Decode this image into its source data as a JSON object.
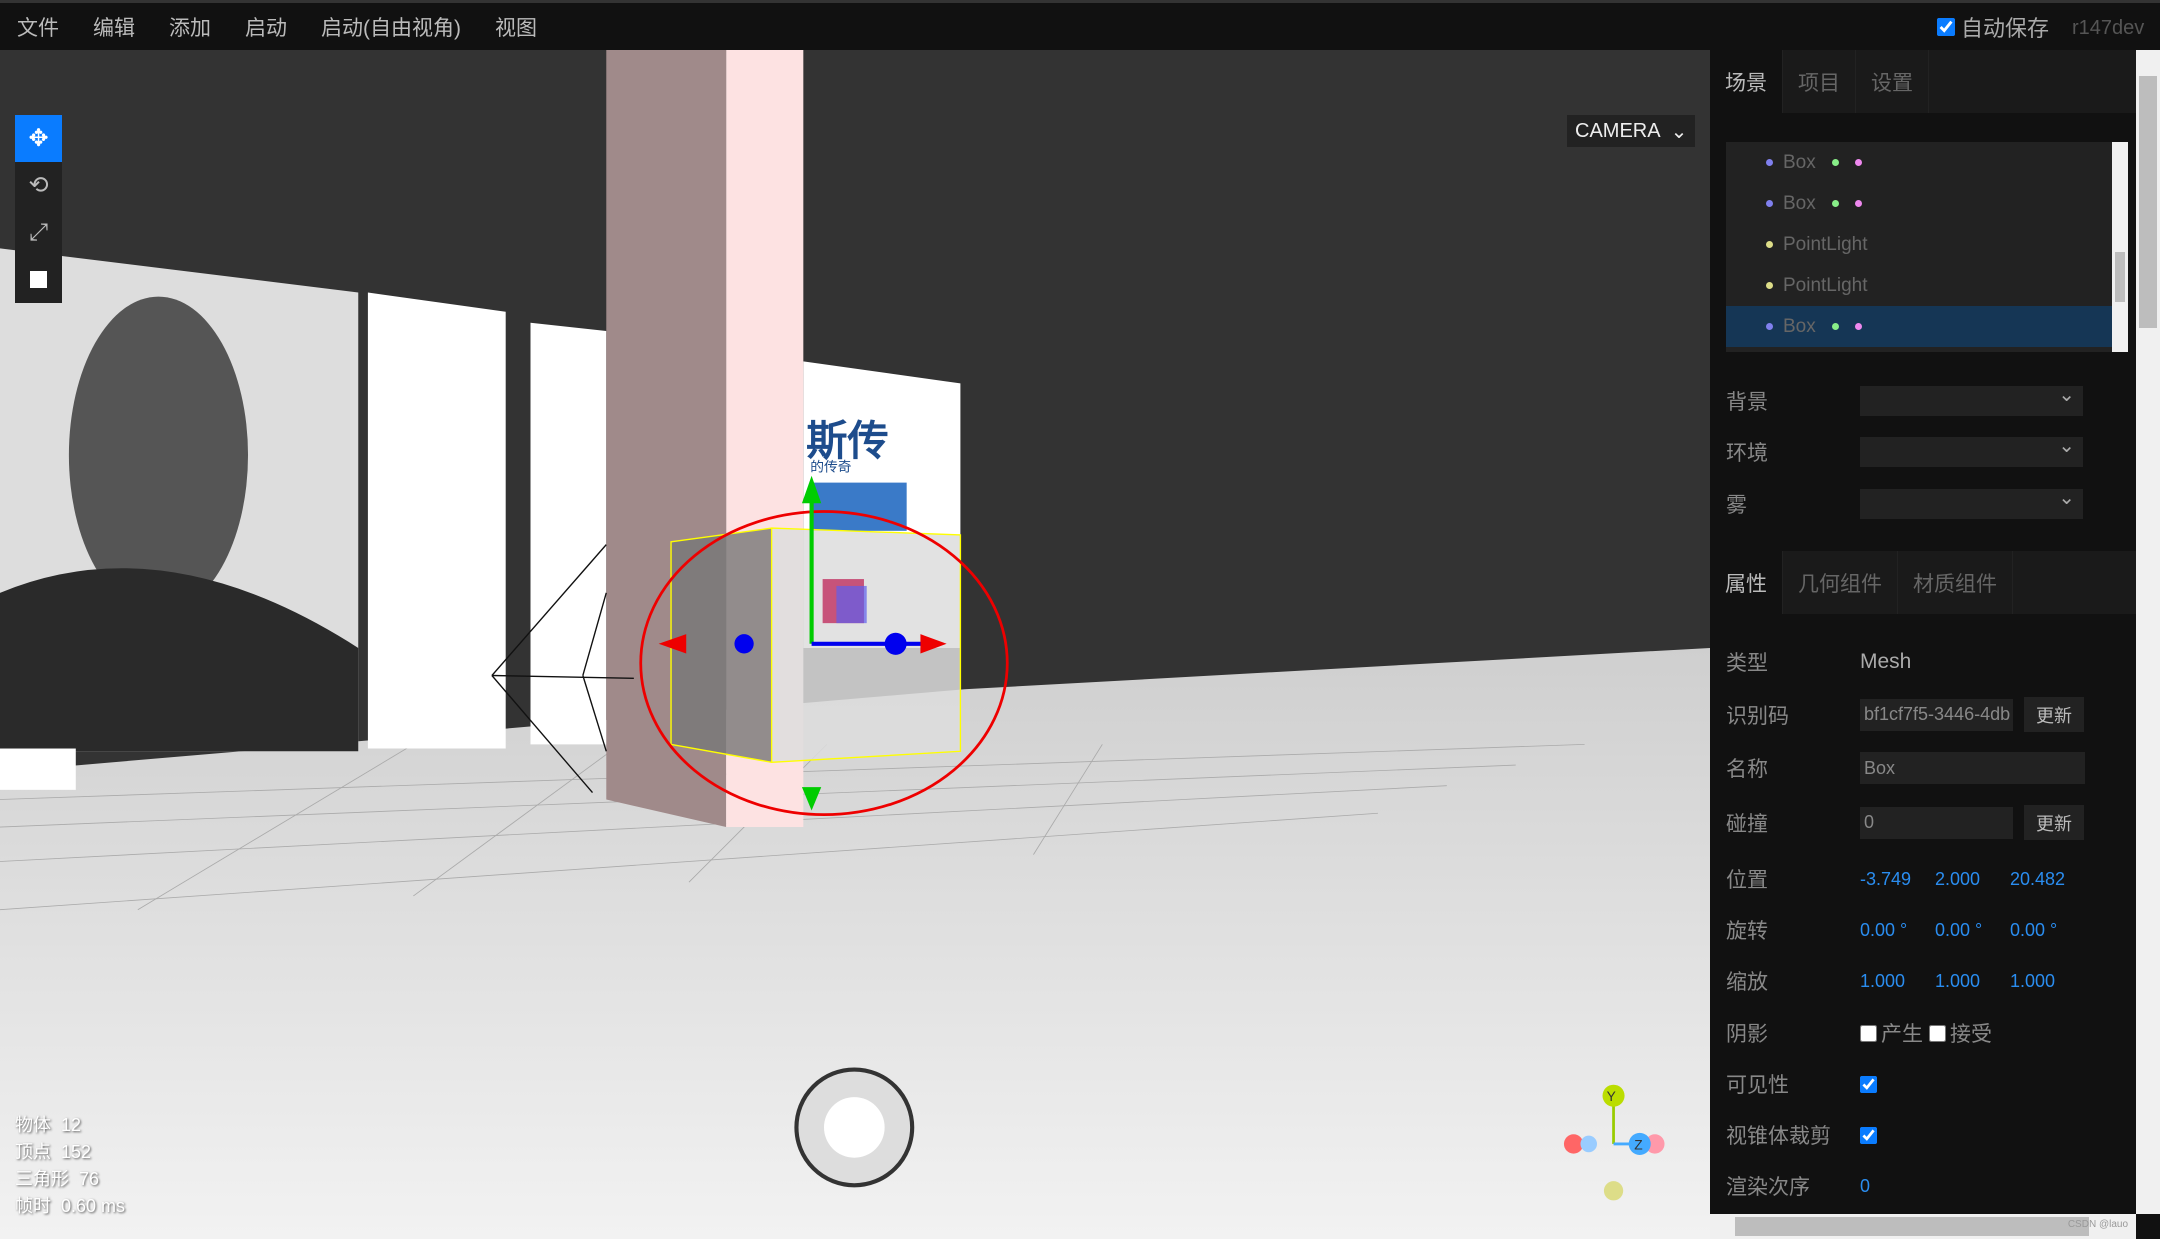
{
  "menubar": {
    "items": [
      "文件",
      "编辑",
      "添加",
      "启动",
      "启动(自由视角)",
      "视图"
    ],
    "autosave_label": "自动保存",
    "autosave_checked": true,
    "version": "r147dev"
  },
  "viewport": {
    "camera": "CAMERA",
    "tools": [
      "move-icon",
      "rotate-icon",
      "scale-icon",
      "local-toggle"
    ],
    "active_tool": "move",
    "poster_text": "斯传",
    "poster_subtext": "的传奇",
    "stats": [
      {
        "label": "物体",
        "value": "12"
      },
      {
        "label": "顶点",
        "value": "152"
      },
      {
        "label": "三角形",
        "value": "76"
      },
      {
        "label": "帧时",
        "value": "0.60 ms"
      }
    ],
    "axis_labels": {
      "y": "Y",
      "z": "Z"
    }
  },
  "panel": {
    "tabs": [
      "场景",
      "项目",
      "设置"
    ],
    "active_tab": "场景",
    "outliner": [
      {
        "name": "Box",
        "type": "mesh"
      },
      {
        "name": "Box",
        "type": "mesh"
      },
      {
        "name": "PointLight",
        "type": "light"
      },
      {
        "name": "PointLight",
        "type": "light"
      },
      {
        "name": "Box",
        "type": "mesh",
        "selected": true
      }
    ],
    "scene_fields": [
      {
        "label": "背景",
        "value": ""
      },
      {
        "label": "环境",
        "value": ""
      },
      {
        "label": "雾",
        "value": ""
      }
    ],
    "prop_tabs": [
      "属性",
      "几何组件",
      "材质组件"
    ],
    "active_prop_tab": "属性",
    "props": {
      "type_label": "类型",
      "type_value": "Mesh",
      "uuid_label": "识别码",
      "uuid_value": "bf1cf7f5-3446-4db",
      "update": "更新",
      "name_label": "名称",
      "name_value": "Box",
      "collision_label": "碰撞",
      "collision_value": "0",
      "position_label": "位置",
      "position": [
        "-3.749",
        "2.000",
        "20.482"
      ],
      "rotation_label": "旋转",
      "rotation": [
        "0.00 °",
        "0.00 °",
        "0.00 °"
      ],
      "scale_label": "缩放",
      "scale": [
        "1.000",
        "1.000",
        "1.000"
      ],
      "shadow_label": "阴影",
      "cast_label": "产生",
      "receive_label": "接受",
      "cast": false,
      "receive": false,
      "visible_label": "可见性",
      "visible": true,
      "frustum_label": "视锥体裁剪",
      "frustum": true,
      "renderorder_label": "渲染次序",
      "renderorder": "0"
    }
  },
  "watermark": "CSDN @lauo",
  "colors": {
    "accent": "#0a7cff",
    "selected_row": "#153655",
    "value": "#2a8df0",
    "mesh_dot": "#8080ee",
    "light_dot": "#dddd88",
    "geom_dot": "#88ee88",
    "mat_dot": "#ee88ee"
  }
}
